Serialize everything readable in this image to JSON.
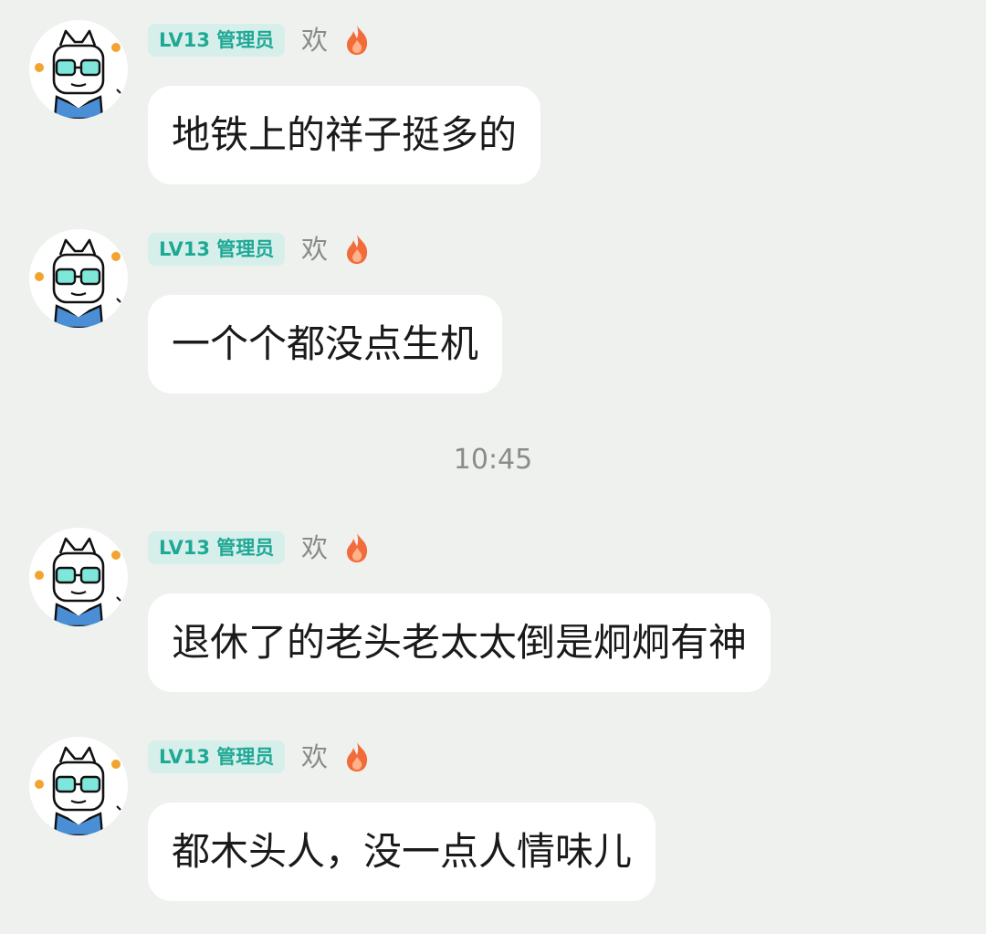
{
  "messages": [
    {
      "badge": "LV13 管理员",
      "nickname": "欢",
      "text": "地铁上的祥子挺多的"
    },
    {
      "badge": "LV13 管理员",
      "nickname": "欢",
      "text": "一个个都没点生机"
    },
    {
      "badge": "LV13 管理员",
      "nickname": "欢",
      "text": "退休了的老头老太太倒是炯炯有神"
    },
    {
      "badge": "LV13 管理员",
      "nickname": "欢",
      "text": "都木头人，没一点人情味儿"
    }
  ],
  "timestamp": "10:45",
  "icons": {
    "avatar": "bunny-glasses-avatar",
    "title": "flame-icon"
  },
  "colors": {
    "badge_bg": "#d6efea",
    "badge_text": "#1fa896",
    "background": "#eef1ee"
  }
}
